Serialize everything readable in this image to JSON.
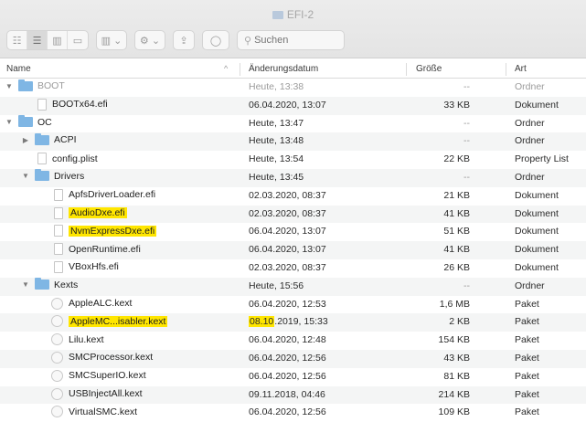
{
  "window": {
    "title": "EFI-2"
  },
  "toolbar": {
    "view_icons": [
      "icon-view-icon",
      "list-view-icon",
      "column-view-icon",
      "gallery-view-icon"
    ],
    "group_label": "▥ ⌄",
    "action_label": "⚙ ⌄",
    "share_label": "⇪",
    "tag_label": "◯",
    "search_placeholder": "Suchen"
  },
  "columns": {
    "name": "Name",
    "date": "Änderungsdatum",
    "size": "Größe",
    "kind": "Art"
  },
  "rows": [
    {
      "name": "BOOT",
      "date": "Heute, 13:38",
      "size": "--",
      "kind": "Ordner",
      "indent": 0,
      "type": "folder",
      "open": true,
      "dim": true
    },
    {
      "name": "BOOTx64.efi",
      "date": "06.04.2020, 13:07",
      "size": "33 KB",
      "kind": "Dokument",
      "indent": 1,
      "type": "file"
    },
    {
      "name": "OC",
      "date": "Heute, 13:47",
      "size": "--",
      "kind": "Ordner",
      "indent": 0,
      "type": "folder",
      "open": true
    },
    {
      "name": "ACPI",
      "date": "Heute, 13:48",
      "size": "--",
      "kind": "Ordner",
      "indent": 1,
      "type": "folder",
      "open": false
    },
    {
      "name": "config.plist",
      "date": "Heute, 13:54",
      "size": "22 KB",
      "kind": "Property List",
      "indent": 1,
      "type": "file"
    },
    {
      "name": "Drivers",
      "date": "Heute, 13:45",
      "size": "--",
      "kind": "Ordner",
      "indent": 1,
      "type": "folder",
      "open": true
    },
    {
      "name": "ApfsDriverLoader.efi",
      "date": "02.03.2020, 08:37",
      "size": "21 KB",
      "kind": "Dokument",
      "indent": 2,
      "type": "file"
    },
    {
      "name": "AudioDxe.efi",
      "date": "02.03.2020, 08:37",
      "size": "41 KB",
      "kind": "Dokument",
      "indent": 2,
      "type": "file",
      "highlight": true
    },
    {
      "name": "NvmExpressDxe.efi",
      "date": "06.04.2020, 13:07",
      "size": "51 KB",
      "kind": "Dokument",
      "indent": 2,
      "type": "file",
      "highlight": true
    },
    {
      "name": "OpenRuntime.efi",
      "date": "06.04.2020, 13:07",
      "size": "41 KB",
      "kind": "Dokument",
      "indent": 2,
      "type": "file"
    },
    {
      "name": "VBoxHfs.efi",
      "date": "02.03.2020, 08:37",
      "size": "26 KB",
      "kind": "Dokument",
      "indent": 2,
      "type": "file"
    },
    {
      "name": "Kexts",
      "date": "Heute, 15:56",
      "size": "--",
      "kind": "Ordner",
      "indent": 1,
      "type": "folder",
      "open": true
    },
    {
      "name": "AppleALC.kext",
      "date": "06.04.2020, 12:53",
      "size": "1,6 MB",
      "kind": "Paket",
      "indent": 2,
      "type": "kext"
    },
    {
      "name": "AppleMC...isabler.kext",
      "date_highlight": "08.10",
      "date_rest": ".2019, 15:33",
      "size": "2 KB",
      "kind": "Paket",
      "indent": 2,
      "type": "kext",
      "highlight": true
    },
    {
      "name": "Lilu.kext",
      "date": "06.04.2020, 12:48",
      "size": "154 KB",
      "kind": "Paket",
      "indent": 2,
      "type": "kext"
    },
    {
      "name": "SMCProcessor.kext",
      "date": "06.04.2020, 12:56",
      "size": "43 KB",
      "kind": "Paket",
      "indent": 2,
      "type": "kext"
    },
    {
      "name": "SMCSuperIO.kext",
      "date": "06.04.2020, 12:56",
      "size": "81 KB",
      "kind": "Paket",
      "indent": 2,
      "type": "kext"
    },
    {
      "name": "USBInjectAll.kext",
      "date": "09.11.2018, 04:46",
      "size": "214 KB",
      "kind": "Paket",
      "indent": 2,
      "type": "kext"
    },
    {
      "name": "VirtualSMC.kext",
      "date": "06.04.2020, 12:56",
      "size": "109 KB",
      "kind": "Paket",
      "indent": 2,
      "type": "kext"
    }
  ]
}
